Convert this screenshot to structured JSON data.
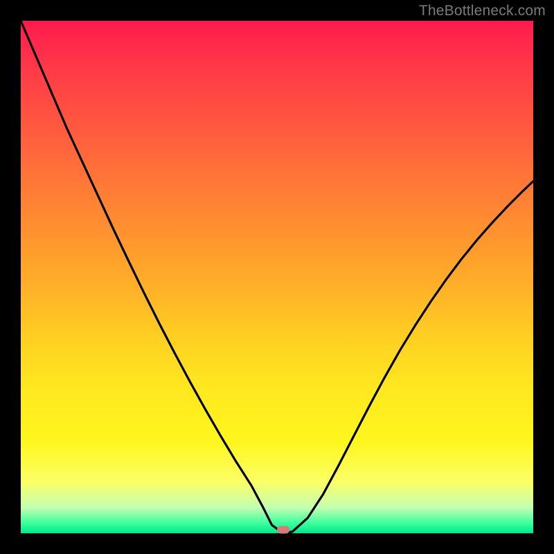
{
  "watermark": "TheBottleneck.com",
  "colors": {
    "frame": "#000000",
    "gradient_top": "#ff1a4d",
    "gradient_bottom": "#00e88a",
    "curve": "#000000",
    "marker": "#d77a78",
    "watermark": "#7a7a7a"
  },
  "chart_data": {
    "type": "line",
    "title": "",
    "xlabel": "",
    "ylabel": "",
    "xlim": [
      0,
      100
    ],
    "ylim": [
      0,
      100
    ],
    "grid": false,
    "x": [
      0,
      3,
      6,
      9,
      12,
      15,
      18,
      21,
      24,
      27,
      30,
      33,
      36,
      39,
      42,
      45,
      47.3,
      49,
      51.2,
      53,
      56,
      59,
      62,
      65,
      68,
      71,
      74,
      77,
      80,
      83,
      86,
      89,
      92,
      95,
      98,
      100
    ],
    "y": [
      100,
      93,
      86,
      79,
      72.5,
      66,
      59.5,
      53.2,
      47,
      41,
      35.2,
      29.6,
      24.2,
      19,
      14,
      9.3,
      5,
      1.6,
      0,
      0.3,
      3,
      7.6,
      13.2,
      19,
      24.8,
      30.4,
      35.7,
      40.6,
      45.2,
      49.5,
      53.5,
      57.2,
      60.6,
      63.8,
      66.8,
      68.7
    ],
    "annotations": [
      {
        "type": "marker",
        "x": 51.2,
        "y": 0
      }
    ]
  }
}
